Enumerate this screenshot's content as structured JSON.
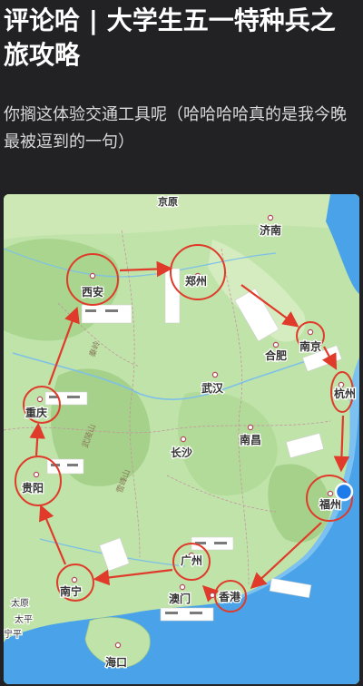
{
  "post": {
    "title": "评论哈 | 大学生五一特种兵之旅攻略",
    "body": "你搁这体验交通工具呢（哈哈哈哈真的是我今晚最被逗到的一句）"
  },
  "map": {
    "cities": {
      "jinan": "济南",
      "xian": "西安",
      "zhengzhou": "郑州",
      "hefei": "合肥",
      "nanjing": "南京",
      "hangzhou": "杭州",
      "wuhan": "武汉",
      "chongqing": "重庆",
      "nanchang": "南昌",
      "changsha": "长沙",
      "guiyang": "贵阳",
      "fuzhou": "福州",
      "guangzhou": "广州",
      "nanning": "南宁",
      "aomen": "澳门",
      "xianggang": "香港",
      "haikou": "海口",
      "taiyuan_partial": "太原",
      "taiping_partial": "太平",
      "ningping_partial": "宁平",
      "top_partial": "京原"
    },
    "regions": {
      "qinling": "秦岭",
      "wuling": "武陵山",
      "xuefeng": "雪峰山"
    },
    "colors": {
      "route": "#e03a2a",
      "land": "#bfe3a9",
      "sea": "#4aa3e8",
      "location_dot": "#1e7bea"
    }
  }
}
